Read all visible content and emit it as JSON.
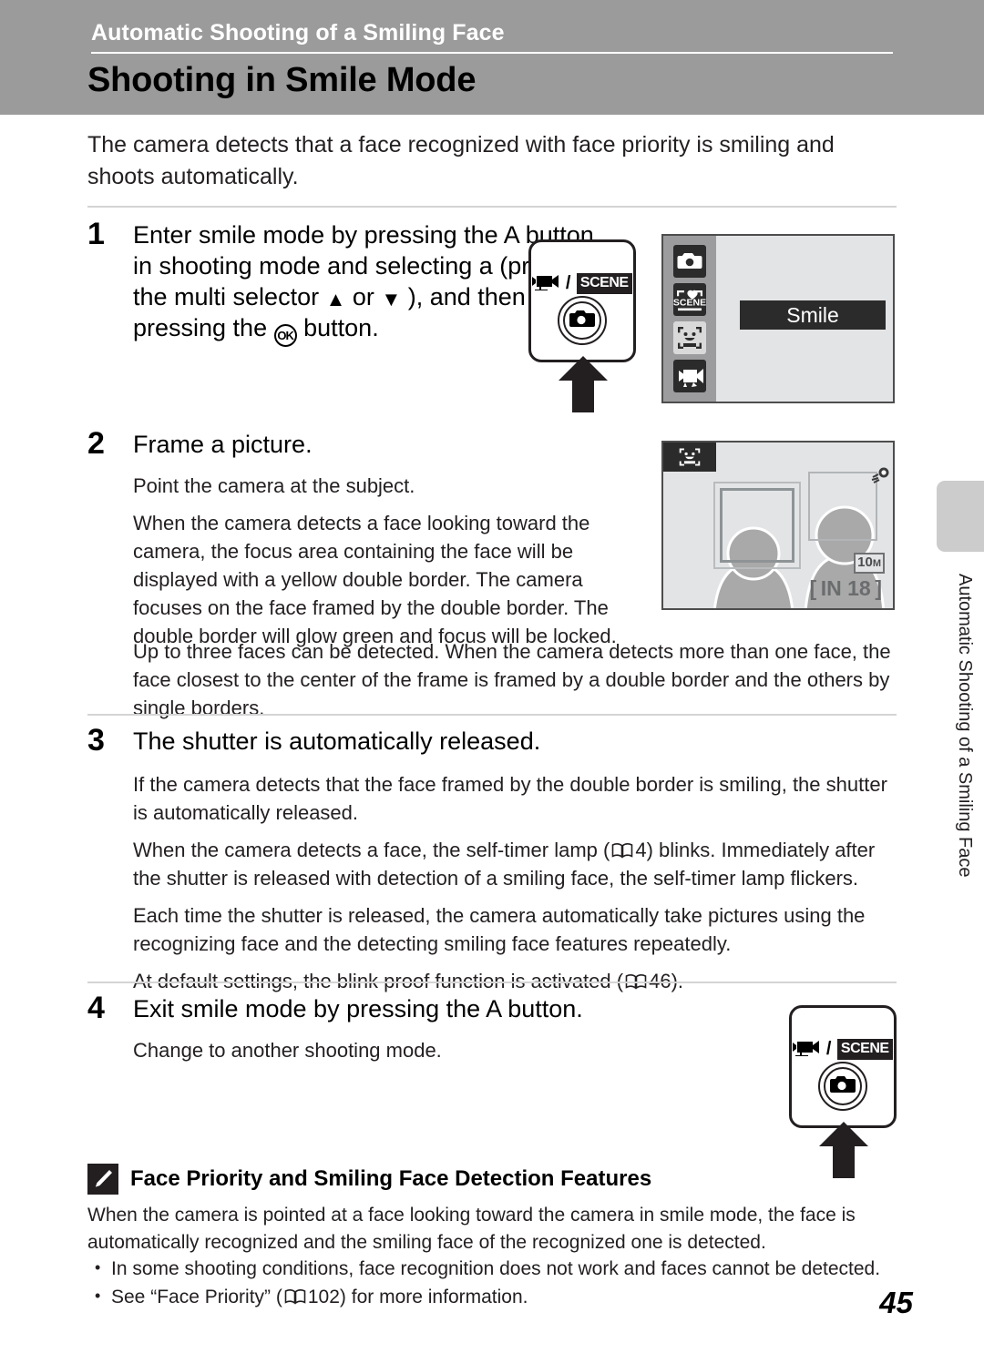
{
  "header": {
    "running_head": "Automatic Shooting of a Smiling Face",
    "title": "Shooting in Smile Mode"
  },
  "intro": "The camera detects that a face recognized with face priority is smiling and shoots automatically.",
  "steps": [
    {
      "number": "1",
      "heading_part1": "Enter smile mode by pressing the A",
      "heading_part2": "button in shooting mode and selecting a",
      "heading_part3": "(press the multi selector",
      "heading_part4": "or",
      "heading_part5": "), and then pressing the",
      "heading_part6": "button.",
      "up_arrow": "▲",
      "down_arrow": "▼",
      "ok_label": "OK"
    },
    {
      "number": "2",
      "heading": "Frame a picture.",
      "paragraphs": [
        "Point the camera at the subject.",
        "When the camera detects a face looking toward the camera, the focus area containing the face will be displayed with a yellow double border. The camera focuses on the face framed by the double border. The double border will glow green and focus will be locked.",
        "Up to three faces can be detected. When the camera detects more than one face, the face closest to the center of the frame is framed by a double border and the others by single borders."
      ]
    },
    {
      "number": "3",
      "heading": "The shutter is automatically released.",
      "paragraphs": [
        "If the camera detects that the face framed by the double border is smiling, the shutter is automatically released.",
        "When the camera detects a face, the self-timer lamp (",
        ") blinks. Immediately after the shutter is released with detection of a smiling face, the self-timer lamp flickers.",
        "Each time the shutter is released, the camera automatically take pictures using the recognizing face and the detecting smiling face features repeatedly.",
        "At default settings, the blink proof function is activated (",
        ")."
      ],
      "ref_page_selftimer": "4",
      "ref_page_blinkproof": "46"
    },
    {
      "number": "4",
      "heading": "Exit smile mode by pressing the A    button.",
      "paragraphs": [
        "Change to another shooting mode."
      ]
    }
  ],
  "button_figure": {
    "movie_icon": "movie-camera-icon",
    "separator": "/",
    "scene_label": "SCENE",
    "camera_icon": "camera-icon",
    "arrow_icon": "up-arrow-icon"
  },
  "lcd_menu": {
    "icons": [
      {
        "name": "auto-mode-icon",
        "selected": false
      },
      {
        "name": "scene-mode-icon",
        "selected": false
      },
      {
        "name": "smile-mode-icon",
        "selected": true
      },
      {
        "name": "movie-mode-icon",
        "selected": false
      }
    ],
    "selected_label": "Smile"
  },
  "lcd_frame": {
    "badge_icon": "smile-mode-icon",
    "image_size": "10",
    "image_size_unit": "M",
    "counter": "[ IN   18 ]",
    "ear_icon": "face-detect-marker-icon"
  },
  "note": {
    "icon": "pencil-note-icon",
    "title": "Face Priority and Smiling Face Detection Features",
    "body": "When the camera is pointed at a face looking toward the camera in smile mode, the face is automatically recognized and the smiling face of the recognized one is detected.",
    "bullets": [
      "In some shooting conditions, face recognition does not work and faces cannot be detected.",
      "See “Face Priority” ( 102) for more information."
    ],
    "bullet2_prefix": "See “Face Priority” (",
    "bullet2_ref": "102",
    "bullet2_suffix": ") for more information."
  },
  "edge_tab": {
    "label": "Automatic Shooting of a Smiling Face"
  },
  "page_number": "45",
  "colors": {
    "header_band": "#9b9b9b",
    "lcd_background": "#e3e4e6",
    "lcd_sidebar": "#9c9c9e",
    "selection_bar": "#2b2b2b",
    "edge_tab": "#cccccc",
    "text": "#231f20"
  }
}
